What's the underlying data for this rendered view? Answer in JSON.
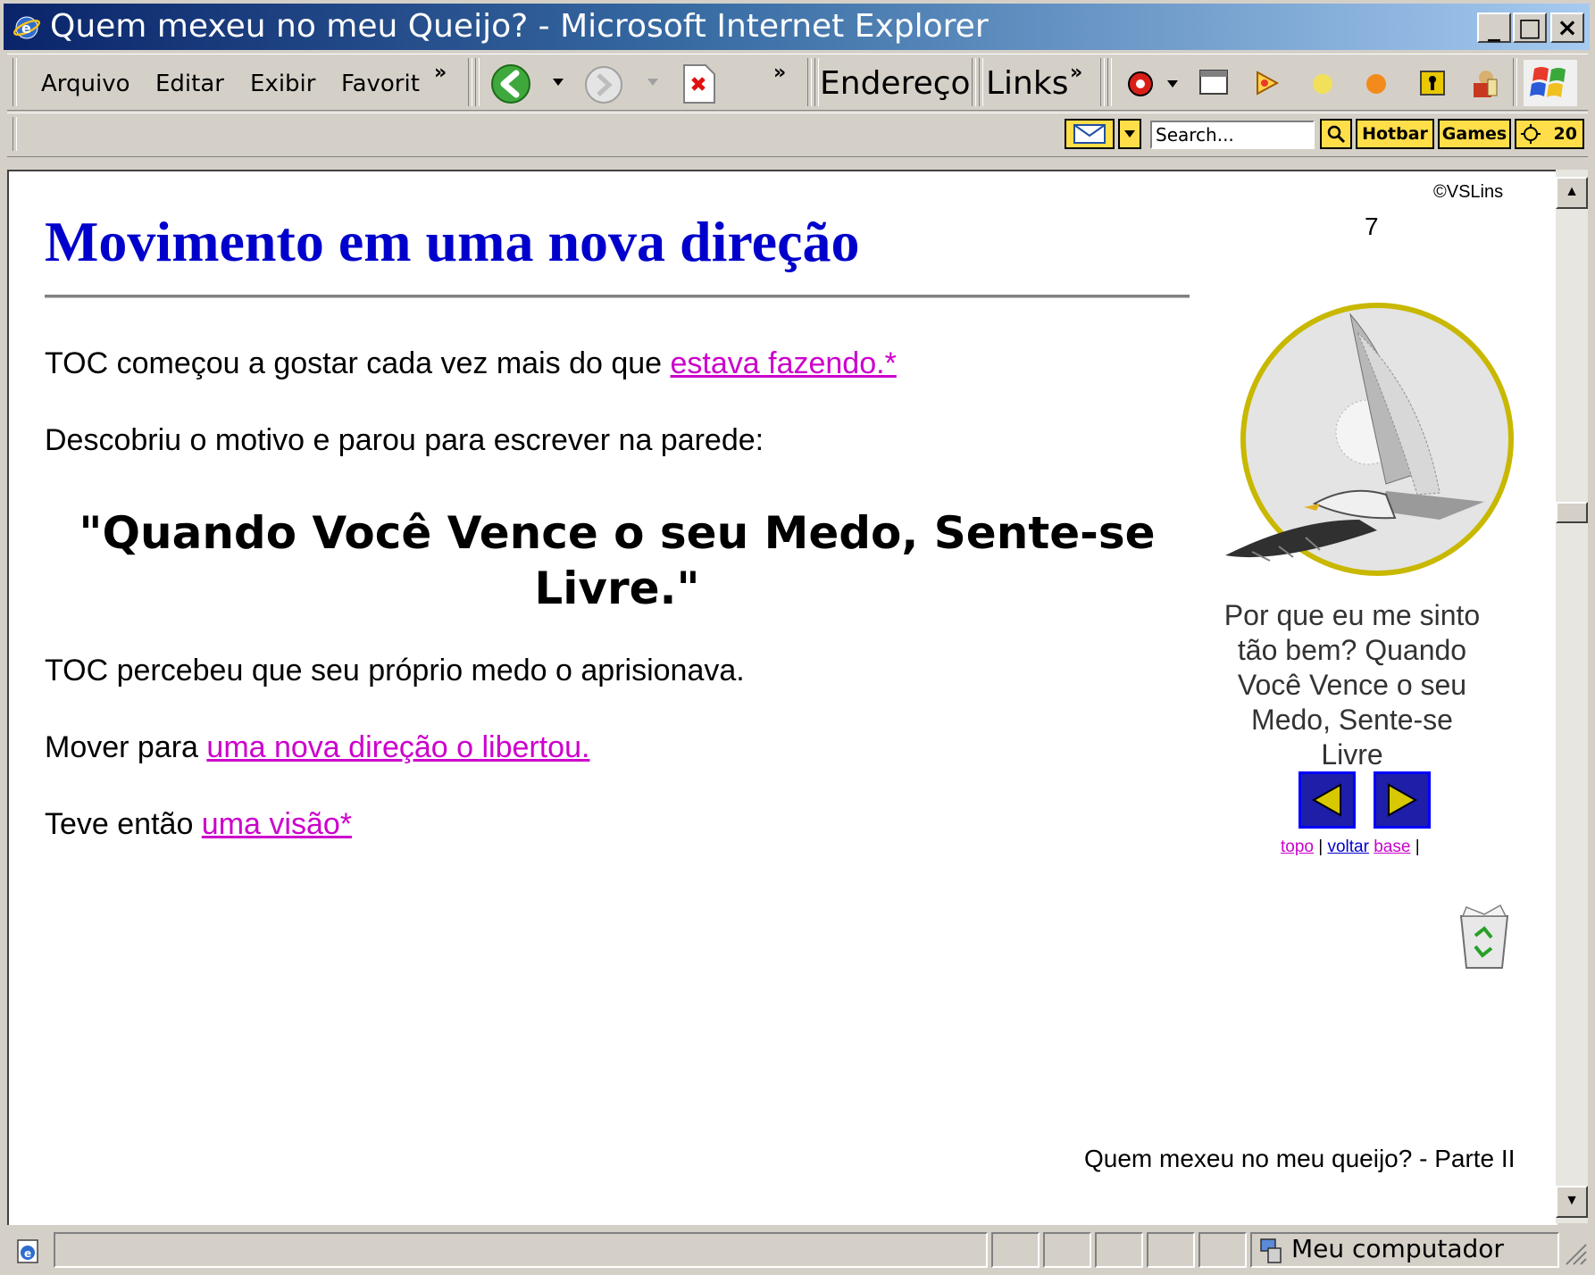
{
  "window": {
    "title": "Quem mexeu no meu Queijo? - Microsoft Internet Explorer",
    "minimize": "_",
    "maximize": "□",
    "close": "×"
  },
  "menu": {
    "items": [
      "Arquivo",
      "Editar",
      "Exibir",
      "Favorit"
    ],
    "chevron": "»"
  },
  "toolbar": {
    "address_label": "Endereço",
    "links_label": "Links",
    "chevron": "»"
  },
  "search_toolbar": {
    "search_placeholder": "Search...",
    "hotbar_label": "Hotbar",
    "games_label": "Games",
    "weather_label": "20"
  },
  "page": {
    "copyright": "©VSLins",
    "page_number": "7",
    "heading": "Movimento em uma nova direção",
    "para1_text": "TOC começou a gostar cada vez mais do que ",
    "para1_link": "estava fazendo.*",
    "para2_text": "Descobriu o motivo e parou para escrever na parede:",
    "quote": "\"Quando Você Vence o seu Medo, Sente-se Livre.\"",
    "para3_text": "TOC percebeu que seu próprio medo o aprisionava.",
    "para4_text": "Mover para ",
    "para4_link": "uma nova direção o libertou.",
    "para5_text": "Teve então ",
    "para5_link": "uma visão*",
    "caption": "Por que eu me sinto tão bem? Quando Você Vence o seu Medo, Sente-se Livre",
    "nav_links": {
      "topo": "topo",
      "sep1": " | ",
      "voltar": "voltar",
      "base": "base",
      "sep2": " |"
    },
    "footer": "Quem mexeu no meu queijo? - Parte II"
  },
  "statusbar": {
    "zone": "Meu computador"
  },
  "colors": {
    "heading": "#0000cc",
    "link": "#cc00cc",
    "titlebar_start": "#0a246a",
    "titlebar_end": "#a6caf0"
  }
}
